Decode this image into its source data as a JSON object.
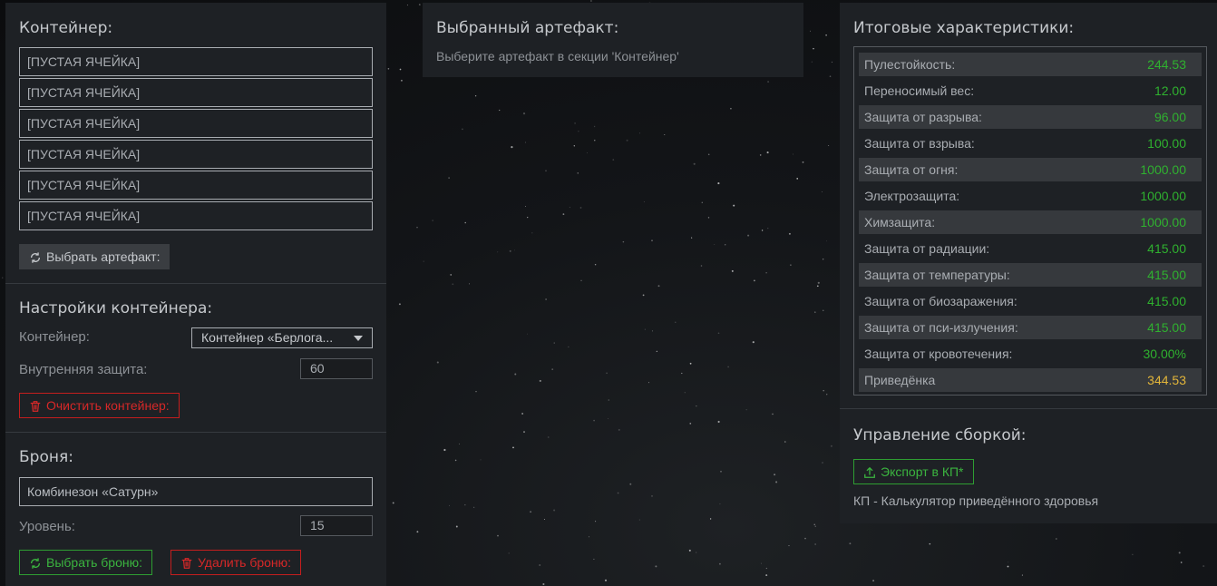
{
  "container": {
    "title": "Контейнер:",
    "slots": [
      "[ПУСТАЯ ЯЧЕЙКА]",
      "[ПУСТАЯ ЯЧЕЙКА]",
      "[ПУСТАЯ ЯЧЕЙКА]",
      "[ПУСТАЯ ЯЧЕЙКА]",
      "[ПУСТАЯ ЯЧЕЙКА]",
      "[ПУСТАЯ ЯЧЕЙКА]"
    ],
    "select_artifact_label": "Выбрать артефакт:"
  },
  "container_settings": {
    "title": "Настройки контейнера:",
    "container_label": "Контейнер:",
    "container_value": "Контейнер «Берлога...",
    "inner_protection_label": "Внутренняя защита:",
    "inner_protection_value": "60",
    "clear_label": "Очистить контейнер:"
  },
  "armor": {
    "title": "Броня:",
    "armor_value": "Комбинезон «Сатурн»",
    "level_label": "Уровень:",
    "level_value": "15",
    "select_label": "Выбрать броню:",
    "delete_label": "Удалить броню:"
  },
  "selected_artifact": {
    "title": "Выбранный артефакт:",
    "hint": "Выберите артефакт в секции 'Контейнер'"
  },
  "totals": {
    "title": "Итоговые характеристики:",
    "rows": [
      {
        "name": "Пулестойкость:",
        "value": "244.53"
      },
      {
        "name": "Переносимый вес:",
        "value": "12.00"
      },
      {
        "name": "Защита от разрыва:",
        "value": "96.00"
      },
      {
        "name": "Защита от взрыва:",
        "value": "100.00"
      },
      {
        "name": "Защита от огня:",
        "value": "1000.00"
      },
      {
        "name": "Электрозащита:",
        "value": "1000.00"
      },
      {
        "name": "Химзащита:",
        "value": "1000.00"
      },
      {
        "name": "Защита от радиации:",
        "value": "415.00"
      },
      {
        "name": "Защита от температуры:",
        "value": "415.00"
      },
      {
        "name": "Защита от биозаражения:",
        "value": "415.00"
      },
      {
        "name": "Защита от пси-излучения:",
        "value": "415.00"
      },
      {
        "name": "Защита от кровотечения:",
        "value": "30.00%"
      },
      {
        "name": "Приведёнка",
        "value": "344.53"
      }
    ]
  },
  "build": {
    "title": "Управление сборкой:",
    "export_label": "Экспорт в КП*",
    "note": "КП - Калькулятор приведённого здоровья"
  },
  "colors": {
    "panel": "#1e2125",
    "accent_green": "#2fb12f",
    "accent_red": "#d62828",
    "accent_yellow": "#e2b53a"
  },
  "icons": [
    "refresh-icon",
    "trash-icon",
    "upload-icon",
    "caret-down-icon"
  ]
}
